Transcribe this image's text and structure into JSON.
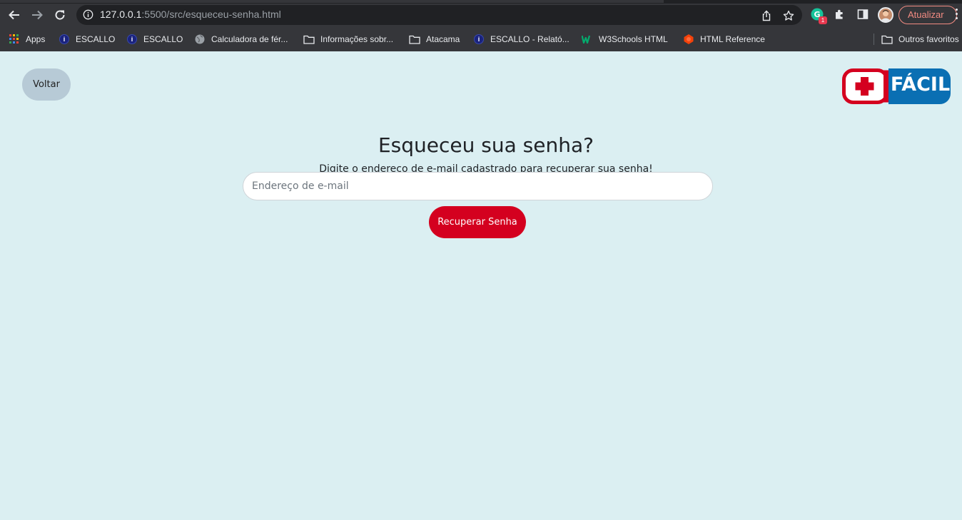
{
  "browser": {
    "url_host": "127.0.0.1",
    "url_rest": ":5500/src/esqueceu-senha.html",
    "extension_badge": "1",
    "update_label": "Atualizar",
    "bookmarks": [
      {
        "label": "Apps",
        "icon": "apps-grid-icon"
      },
      {
        "label": "ESCALLO",
        "icon": "escallo-icon"
      },
      {
        "label": "ESCALLO",
        "icon": "escallo-icon"
      },
      {
        "label": "Calculadora de fér...",
        "icon": "globe-icon"
      },
      {
        "label": "Informações sobr...",
        "icon": "folder-icon"
      },
      {
        "label": "Atacama",
        "icon": "folder-icon"
      },
      {
        "label": "ESCALLO - Relató...",
        "icon": "escallo-icon"
      },
      {
        "label": "W3Schools HTML",
        "icon": "w3schools-icon"
      },
      {
        "label": "HTML Reference",
        "icon": "html-reference-icon"
      }
    ],
    "other_bookmarks": "Outros favoritos"
  },
  "page": {
    "back_label": "Voltar",
    "logo_text": "FÁCIL",
    "title": "Esqueceu sua senha?",
    "subtitle": "Digite o endereço de e-mail cadastrado para recuperar sua senha!",
    "email_placeholder": "Endereço de e-mail",
    "email_value": "",
    "submit_label": "Recuperar Senha"
  },
  "colors": {
    "page_background": "#dbeff2",
    "brand_red": "#d4001f",
    "brand_blue": "#0a6fb3",
    "back_button": "#b7cad6"
  }
}
